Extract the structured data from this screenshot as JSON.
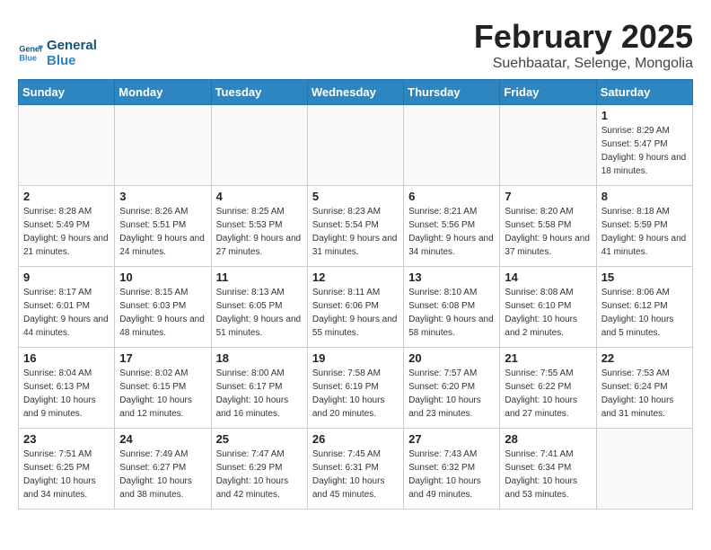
{
  "logo": {
    "line1": "General",
    "line2": "Blue"
  },
  "header": {
    "title": "February 2025",
    "subtitle": "Suehbaatar, Selenge, Mongolia"
  },
  "weekdays": [
    "Sunday",
    "Monday",
    "Tuesday",
    "Wednesday",
    "Thursday",
    "Friday",
    "Saturday"
  ],
  "weeks": [
    [
      {
        "day": "",
        "info": ""
      },
      {
        "day": "",
        "info": ""
      },
      {
        "day": "",
        "info": ""
      },
      {
        "day": "",
        "info": ""
      },
      {
        "day": "",
        "info": ""
      },
      {
        "day": "",
        "info": ""
      },
      {
        "day": "1",
        "info": "Sunrise: 8:29 AM\nSunset: 5:47 PM\nDaylight: 9 hours and 18 minutes."
      }
    ],
    [
      {
        "day": "2",
        "info": "Sunrise: 8:28 AM\nSunset: 5:49 PM\nDaylight: 9 hours and 21 minutes."
      },
      {
        "day": "3",
        "info": "Sunrise: 8:26 AM\nSunset: 5:51 PM\nDaylight: 9 hours and 24 minutes."
      },
      {
        "day": "4",
        "info": "Sunrise: 8:25 AM\nSunset: 5:53 PM\nDaylight: 9 hours and 27 minutes."
      },
      {
        "day": "5",
        "info": "Sunrise: 8:23 AM\nSunset: 5:54 PM\nDaylight: 9 hours and 31 minutes."
      },
      {
        "day": "6",
        "info": "Sunrise: 8:21 AM\nSunset: 5:56 PM\nDaylight: 9 hours and 34 minutes."
      },
      {
        "day": "7",
        "info": "Sunrise: 8:20 AM\nSunset: 5:58 PM\nDaylight: 9 hours and 37 minutes."
      },
      {
        "day": "8",
        "info": "Sunrise: 8:18 AM\nSunset: 5:59 PM\nDaylight: 9 hours and 41 minutes."
      }
    ],
    [
      {
        "day": "9",
        "info": "Sunrise: 8:17 AM\nSunset: 6:01 PM\nDaylight: 9 hours and 44 minutes."
      },
      {
        "day": "10",
        "info": "Sunrise: 8:15 AM\nSunset: 6:03 PM\nDaylight: 9 hours and 48 minutes."
      },
      {
        "day": "11",
        "info": "Sunrise: 8:13 AM\nSunset: 6:05 PM\nDaylight: 9 hours and 51 minutes."
      },
      {
        "day": "12",
        "info": "Sunrise: 8:11 AM\nSunset: 6:06 PM\nDaylight: 9 hours and 55 minutes."
      },
      {
        "day": "13",
        "info": "Sunrise: 8:10 AM\nSunset: 6:08 PM\nDaylight: 9 hours and 58 minutes."
      },
      {
        "day": "14",
        "info": "Sunrise: 8:08 AM\nSunset: 6:10 PM\nDaylight: 10 hours and 2 minutes."
      },
      {
        "day": "15",
        "info": "Sunrise: 8:06 AM\nSunset: 6:12 PM\nDaylight: 10 hours and 5 minutes."
      }
    ],
    [
      {
        "day": "16",
        "info": "Sunrise: 8:04 AM\nSunset: 6:13 PM\nDaylight: 10 hours and 9 minutes."
      },
      {
        "day": "17",
        "info": "Sunrise: 8:02 AM\nSunset: 6:15 PM\nDaylight: 10 hours and 12 minutes."
      },
      {
        "day": "18",
        "info": "Sunrise: 8:00 AM\nSunset: 6:17 PM\nDaylight: 10 hours and 16 minutes."
      },
      {
        "day": "19",
        "info": "Sunrise: 7:58 AM\nSunset: 6:19 PM\nDaylight: 10 hours and 20 minutes."
      },
      {
        "day": "20",
        "info": "Sunrise: 7:57 AM\nSunset: 6:20 PM\nDaylight: 10 hours and 23 minutes."
      },
      {
        "day": "21",
        "info": "Sunrise: 7:55 AM\nSunset: 6:22 PM\nDaylight: 10 hours and 27 minutes."
      },
      {
        "day": "22",
        "info": "Sunrise: 7:53 AM\nSunset: 6:24 PM\nDaylight: 10 hours and 31 minutes."
      }
    ],
    [
      {
        "day": "23",
        "info": "Sunrise: 7:51 AM\nSunset: 6:25 PM\nDaylight: 10 hours and 34 minutes."
      },
      {
        "day": "24",
        "info": "Sunrise: 7:49 AM\nSunset: 6:27 PM\nDaylight: 10 hours and 38 minutes."
      },
      {
        "day": "25",
        "info": "Sunrise: 7:47 AM\nSunset: 6:29 PM\nDaylight: 10 hours and 42 minutes."
      },
      {
        "day": "26",
        "info": "Sunrise: 7:45 AM\nSunset: 6:31 PM\nDaylight: 10 hours and 45 minutes."
      },
      {
        "day": "27",
        "info": "Sunrise: 7:43 AM\nSunset: 6:32 PM\nDaylight: 10 hours and 49 minutes."
      },
      {
        "day": "28",
        "info": "Sunrise: 7:41 AM\nSunset: 6:34 PM\nDaylight: 10 hours and 53 minutes."
      },
      {
        "day": "",
        "info": ""
      }
    ]
  ]
}
